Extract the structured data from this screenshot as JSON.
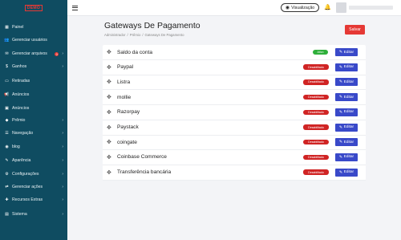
{
  "sidebar": {
    "logo": "DEMO",
    "items": [
      {
        "label": "Painel",
        "icon": "dashboard-icon",
        "glyph": "▦",
        "chevron": false,
        "badge": ""
      },
      {
        "label": "Gerenciar usuários",
        "icon": "users-icon",
        "glyph": "👥",
        "chevron": false,
        "badge": ""
      },
      {
        "label": "Gerenciar arquivos",
        "icon": "files-icon",
        "glyph": "✉",
        "chevron": true,
        "badge": "0"
      },
      {
        "label": "Ganhos",
        "icon": "dollar-icon",
        "glyph": "$",
        "chevron": true,
        "badge": ""
      },
      {
        "label": "Retiradas",
        "icon": "wallet-icon",
        "glyph": "▭",
        "chevron": false,
        "badge": ""
      },
      {
        "label": "Anúncios",
        "icon": "megaphone-icon",
        "glyph": "📢",
        "chevron": false,
        "badge": ""
      },
      {
        "label": "Anúncios",
        "icon": "ad-icon",
        "glyph": "▣",
        "chevron": false,
        "badge": ""
      },
      {
        "label": "Prêmio",
        "icon": "diamond-icon",
        "glyph": "◆",
        "chevron": true,
        "badge": ""
      },
      {
        "label": "Navegação",
        "icon": "navigation-icon",
        "glyph": "☰",
        "chevron": true,
        "badge": ""
      },
      {
        "label": "blog",
        "icon": "rss-icon",
        "glyph": "◉",
        "chevron": true,
        "badge": ""
      },
      {
        "label": "Aparência",
        "icon": "paint-icon",
        "glyph": "✎",
        "chevron": true,
        "badge": ""
      },
      {
        "label": "Configurações",
        "icon": "gear-icon",
        "glyph": "⚙",
        "chevron": true,
        "badge": ""
      },
      {
        "label": "Gerenciar ações",
        "icon": "actions-icon",
        "glyph": "⇄",
        "chevron": true,
        "badge": ""
      },
      {
        "label": "Recursos Extras",
        "icon": "extras-icon",
        "glyph": "✚",
        "chevron": true,
        "badge": ""
      },
      {
        "label": "Sistema",
        "icon": "system-icon",
        "glyph": "▤",
        "chevron": true,
        "badge": ""
      }
    ]
  },
  "topbar": {
    "preview_label": "Visualização"
  },
  "page": {
    "title": "Gateways De Pagamento",
    "breadcrumb": [
      "Administrador",
      "Prêmio",
      "Gateways De Pagamento"
    ],
    "save_label": "Salvar"
  },
  "gateways": [
    {
      "name": "Saldo da conta",
      "status": "Ativo",
      "active": true
    },
    {
      "name": "Paypal",
      "status": "Desabilitado",
      "active": false
    },
    {
      "name": "Listra",
      "status": "Desabilitado",
      "active": false
    },
    {
      "name": "mollie",
      "status": "Desabilitado",
      "active": false
    },
    {
      "name": "Razorpay",
      "status": "Desabilitado",
      "active": false
    },
    {
      "name": "Paystack",
      "status": "Desabilitado",
      "active": false
    },
    {
      "name": "coingate",
      "status": "Desabilitado",
      "active": false
    },
    {
      "name": "Coinbase Commerce",
      "status": "Desabilitado",
      "active": false
    },
    {
      "name": "Transferência bancária",
      "status": "Desabilitado",
      "active": false
    }
  ],
  "edit_label": "Editar",
  "colors": {
    "sidebar": "#0f4c61",
    "save": "#e53935",
    "edit": "#3949c9",
    "active": "#2eaf3a",
    "disabled": "#d02424"
  }
}
